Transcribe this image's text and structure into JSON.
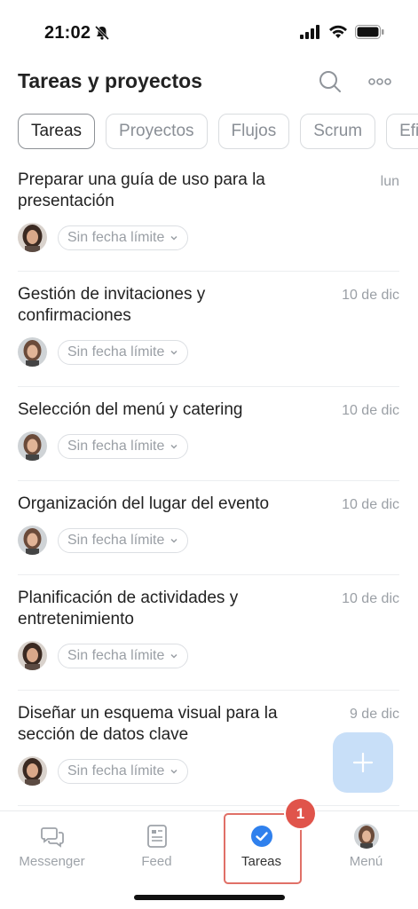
{
  "status_bar": {
    "time": "21:02"
  },
  "header": {
    "title": "Tareas y proyectos"
  },
  "tabs": [
    {
      "label": "Tareas",
      "active": true
    },
    {
      "label": "Proyectos",
      "active": false
    },
    {
      "label": "Flujos",
      "active": false
    },
    {
      "label": "Scrum",
      "active": false
    },
    {
      "label": "Efi",
      "active": false
    }
  ],
  "tasks": [
    {
      "title": "Preparar una guía de uso para la presentación",
      "date": "lun",
      "deadline": "Sin fecha límite"
    },
    {
      "title": "Gestión de invitaciones y confirmaciones",
      "date": "10 de dic",
      "deadline": "Sin fecha límite"
    },
    {
      "title": "Selección del menú y catering",
      "date": "10 de dic",
      "deadline": "Sin fecha límite"
    },
    {
      "title": "Organización del lugar del evento",
      "date": "10 de dic",
      "deadline": "Sin fecha límite"
    },
    {
      "title": "Planificación de actividades y entretenimiento",
      "date": "10 de dic",
      "deadline": "Sin fecha límite"
    },
    {
      "title": "Diseñar un esquema visual para la sección de datos clave",
      "date": "9 de dic",
      "deadline": "Sin fecha límite"
    }
  ],
  "nav": {
    "messenger": "Messenger",
    "feed": "Feed",
    "tareas": "Tareas",
    "menu": "Menú",
    "badge": "1"
  },
  "colors": {
    "accent": "#2f80ed",
    "fab": "#c8dff8",
    "highlight": "#e07067",
    "badge": "#e0544b"
  }
}
